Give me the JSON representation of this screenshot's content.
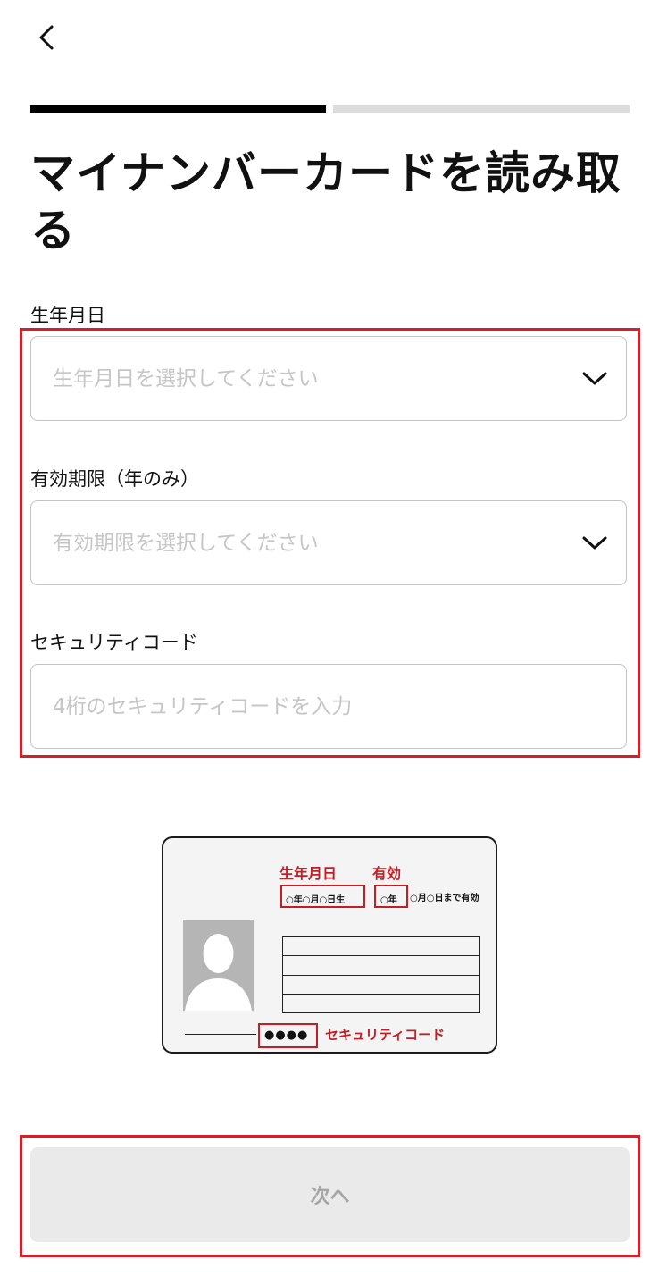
{
  "header": {
    "back_icon": "chevron-left-icon"
  },
  "progress": {
    "current_step": 1,
    "total_steps": 2
  },
  "page": {
    "title": "マイナンバーカードを読み取る"
  },
  "form": {
    "birthdate": {
      "label": "生年月日",
      "placeholder": "生年月日を選択してください",
      "icon": "chevron-down-icon"
    },
    "expiry": {
      "label": "有効期限（年のみ）",
      "placeholder": "有効期限を選択してください",
      "icon": "chevron-down-icon"
    },
    "security_code": {
      "label": "セキュリティコード",
      "placeholder": "4桁のセキュリティコードを入力"
    }
  },
  "card_illustration": {
    "birthdate_label": "生年月日",
    "expiry_label": "有効",
    "birthdate_value": "○年○月○日生",
    "expiry_year": "○年",
    "expiry_rest": "○月○日まで有効",
    "security_dots": "●●●●",
    "security_label": "セキュリティコード"
  },
  "footer": {
    "next_label": "次へ"
  },
  "colors": {
    "accent_red": "#d5202a",
    "progress_active": "#000000",
    "button_disabled": "#eaeaea"
  }
}
